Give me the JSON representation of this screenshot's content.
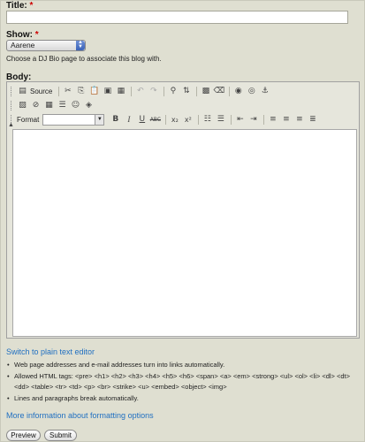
{
  "title_field": {
    "label": "Title:",
    "required_mark": "*",
    "value": ""
  },
  "show_field": {
    "label": "Show:",
    "required_mark": "*",
    "selected": "Aarene",
    "help": "Choose a DJ Bio page to associate this blog with."
  },
  "body_field": {
    "label": "Body:"
  },
  "toolbar": {
    "source_label": "Source",
    "format_label": "Format",
    "format_value": "",
    "bold": "B",
    "italic": "I",
    "underline": "U",
    "strike": "ABC",
    "subscript": "x₂",
    "superscript": "x²"
  },
  "switch_link": "Switch to plain text editor",
  "tips": [
    "Web page addresses and e-mail addresses turn into links automatically.",
    "Allowed HTML tags: <pre> <h1> <h2> <h3> <h4> <h5> <h6> <span> <a> <em> <strong> <ul> <ol> <li> <dl> <dt> <dd> <table> <tr> <td> <p> <br> <strike> <u> <embed> <object> <img>",
    "Lines and paragraphs break automatically."
  ],
  "more_info_link": "More information about formatting options",
  "buttons": {
    "preview": "Preview",
    "submit": "Submit"
  },
  "colors": {
    "background": "#dfdfd1",
    "link": "#1f6fc1",
    "required": "#cc0000"
  }
}
